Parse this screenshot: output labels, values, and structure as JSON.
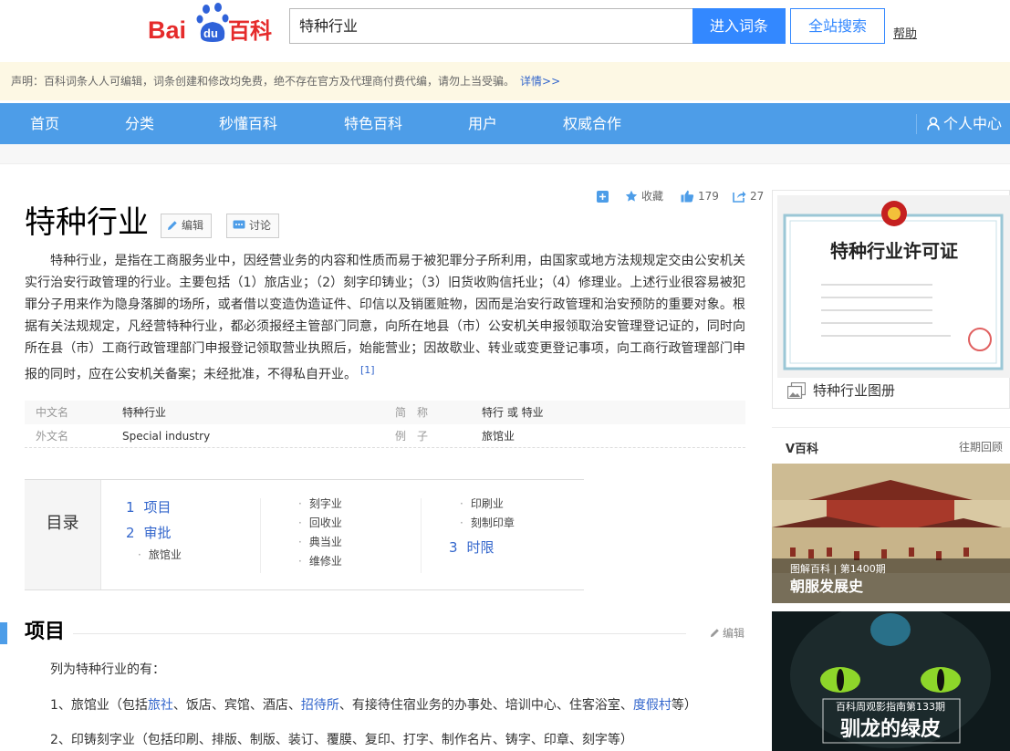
{
  "header": {
    "logo_text_latin": "Bai",
    "logo_text_du": "du",
    "logo_text_cn": "百科",
    "search_value": "特种行业",
    "enter_button": "进入词条",
    "site_search_button": "全站搜索",
    "help_link": "帮助"
  },
  "notice": {
    "text": "声明：百科词条人人可编辑，词条创建和修改均免费，绝不存在官方及代理商付费代编，请勿上当受骗。",
    "more": "详情>>"
  },
  "nav": {
    "items": [
      "首页",
      "分类",
      "秒懂百科",
      "特色百科",
      "用户",
      "权威合作"
    ],
    "user_center": "个人中心"
  },
  "tools": {
    "collect": "收藏",
    "likes": "179",
    "shares": "27"
  },
  "entry": {
    "title": "特种行业",
    "edit_button": "编辑",
    "discuss_button": "讨论",
    "summary": "特种行业，是指在工商服务业中，因经营业务的内容和性质而易于被犯罪分子所利用，由国家或地方法规规定交由公安机关实行治安行政管理的行业。主要包括（1）旅店业；（2）刻字印铸业；（3）旧货收购信托业；（4）修理业。上述行业很容易被犯罪分子用来作为隐身落脚的场所，或者借以变造伪造证件、印信以及销匿赃物，因而是治安行政管理和治安预防的重要对象。根据有关法规规定，凡经营特种行业，都必须报经主管部门同意，向所在地县（市）公安机关申报领取治安管理登记证的，同时向所在县（市）工商行政管理部门申报登记领取营业执照后，始能营业；因故歇业、转业或变更登记事项，向工商行政管理部门申报的同时，应在公安机关备案；未经批准，不得私自开业。",
    "summary_ref": "[1]"
  },
  "basic_info": {
    "r1": {
      "k1": "中文名",
      "v1": "特种行业",
      "k2": "简　称",
      "v2": "特行 或 特业"
    },
    "r2": {
      "k1": "外文名",
      "v1": "Special industry",
      "k2": "例　子",
      "v2": "旅馆业"
    }
  },
  "catalog": {
    "label": "目录",
    "l1": [
      {
        "num": "1",
        "text": "项目"
      },
      {
        "num": "2",
        "text": "审批"
      },
      {
        "num": "3",
        "text": "时限"
      }
    ],
    "l2_sub_of_2": [
      "旅馆业"
    ],
    "l2_col2": [
      "刻字业",
      "回收业",
      "典当业",
      "维修业"
    ],
    "l2_col3": [
      "印刷业",
      "刻制印章"
    ]
  },
  "section": {
    "title": "项目",
    "edit": "编辑",
    "intro": "列为特种行业的有：",
    "line1_parts": [
      "1、旅馆业（包括",
      "旅社",
      "、饭店、宾馆、酒店、",
      "招待所",
      "、有接待住宿业务的办事处、培训中心、住客浴室、",
      "度假村",
      "等）"
    ],
    "line2": "2、印铸刻字业（包括印刷、排版、制版、装订、覆膜、复印、打字、制作名片、铸字、印章、刻字等）"
  },
  "sidebar": {
    "album_caption": "特种行业图册",
    "album_image_title": "特种行业许可证",
    "vbaike_title": "V百科",
    "vbaike_more": "往期回顾",
    "card1_sub": "图解百科 | 第1400期",
    "card1_main": "朝服发展史",
    "card2_sub": "百科周观影指南第133期",
    "card2_main": "驯龙的绿皮"
  },
  "colors": {
    "nav_blue": "#4d9de8",
    "button_blue": "#3388ff",
    "link_blue": "#3366cc",
    "notice_bg": "#fdf8e4"
  }
}
